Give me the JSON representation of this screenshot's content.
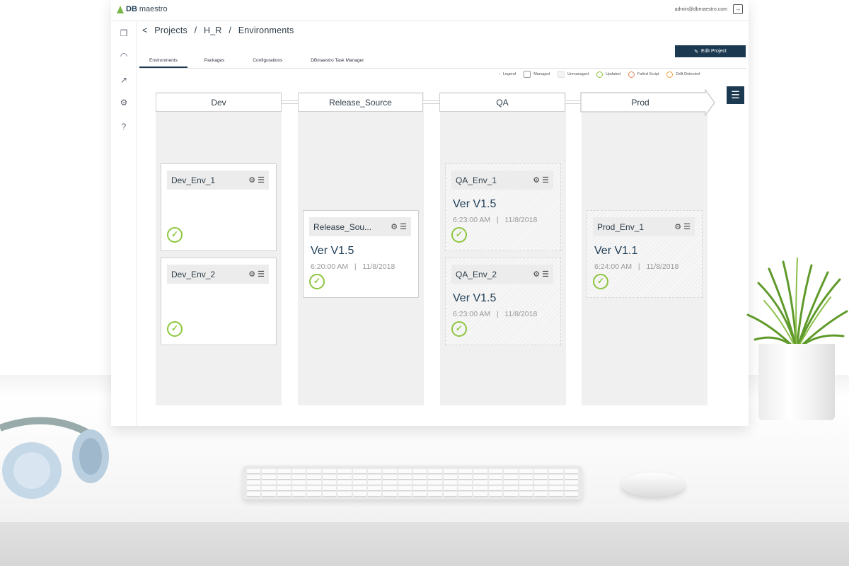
{
  "app": {
    "logo_prefix": "DB",
    "logo_suffix": "maestro",
    "user_email": "admin@dbmaestro.com"
  },
  "breadcrumb": {
    "back": "<",
    "items": [
      "Projects",
      "/",
      "H_R",
      "/",
      "Environments"
    ]
  },
  "edit_button": {
    "icon": "pencil-icon",
    "label": "Edit Project"
  },
  "tabs": [
    "Environments",
    "Packages",
    "Configurations",
    "DBmaestro Task Manager"
  ],
  "active_tab": "Environments",
  "legend": {
    "toggle": "Legend",
    "items": [
      {
        "label": "Managed",
        "icon": "managed-square"
      },
      {
        "label": "Unmanaged",
        "icon": "unmanaged-square"
      },
      {
        "label": "Updated",
        "icon": "updated-circle",
        "color": "#8dc63f"
      },
      {
        "label": "Failed Script",
        "icon": "failed-circle",
        "color": "#e8845a"
      },
      {
        "label": "Drift Detected",
        "icon": "drift-circle",
        "color": "#f0a040"
      }
    ]
  },
  "stages": [
    "Dev",
    "Release_Source",
    "QA",
    "Prod"
  ],
  "environments": {
    "dev_env_1": {
      "name": "Dev_Env_1"
    },
    "dev_env_2": {
      "name": "Dev_Env_2"
    },
    "release_source": {
      "name": "Release_Sou...",
      "version": "Ver V1.5",
      "time": "6:20:00 AM",
      "separator": "|",
      "date": "11/8/2018"
    },
    "qa_env_1": {
      "name": "QA_Env_1",
      "version": "Ver V1.5",
      "time": "6:23:00 AM",
      "separator": "|",
      "date": "11/8/2018"
    },
    "qa_env_2": {
      "name": "QA_Env_2",
      "version": "Ver V1.5",
      "time": "6:23:00 AM",
      "separator": "|",
      "date": "11/8/2018"
    },
    "prod_env_1": {
      "name": "Prod_Env_1",
      "version": "Ver V1.1",
      "time": "6:24:00 AM",
      "separator": "|",
      "date": "11/8/2018"
    }
  },
  "colors": {
    "brand_navy": "#1b3a52",
    "success_green": "#8dc63f"
  }
}
